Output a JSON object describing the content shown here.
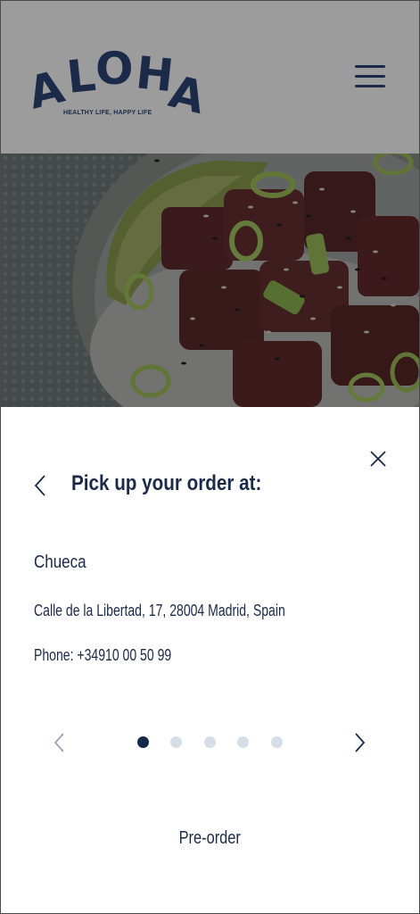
{
  "header": {
    "logo_text": "ALOHA",
    "tagline": "HEALTHY LIFE, HAPPY LIFE",
    "menu_icon": "hamburger-menu-icon"
  },
  "hero": {
    "image": "poke-bowl-photo"
  },
  "pickup_sheet": {
    "close_icon": "close-icon",
    "back_icon": "chevron-left-icon",
    "title": "Pick up your order at:",
    "location": {
      "name": "Chueca",
      "address": "Calle de la Libertad, 17, 28004 Madrid, Spain",
      "phone": "Phone: +34910 00 50 99"
    },
    "carousel": {
      "prev_icon": "chevron-left-icon",
      "next_icon": "chevron-right-icon",
      "page_count": 5,
      "active_index": 0
    },
    "preorder_label": "Pre-order"
  },
  "colors": {
    "primary": "#1b2a48",
    "dot_active": "#13284a",
    "dot_inactive": "#d5dde6",
    "overlay_header": "#9c9c9c",
    "sheet_background": "#ffffff"
  }
}
